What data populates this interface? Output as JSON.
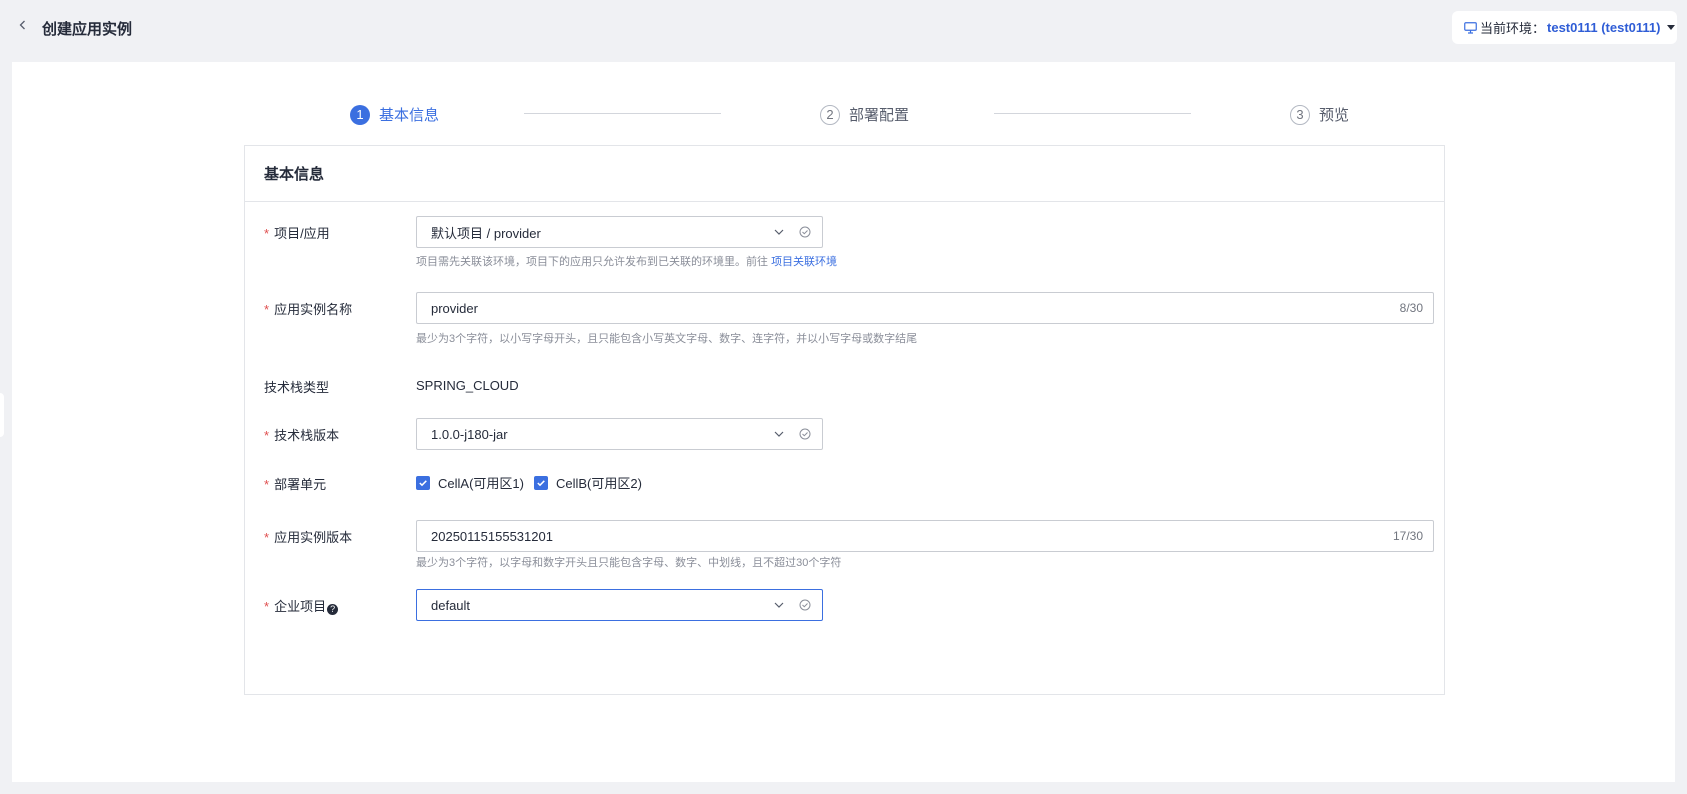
{
  "header": {
    "title": "创建应用实例",
    "env_label": "当前环境：",
    "env_value": "test0111 (test0111)"
  },
  "steps": [
    {
      "num": "1",
      "label": "基本信息",
      "state": "active"
    },
    {
      "num": "2",
      "label": "部署配置",
      "state": "inactive"
    },
    {
      "num": "3",
      "label": "预览",
      "state": "inactive"
    }
  ],
  "form": {
    "section_title": "基本信息",
    "project_app": {
      "label": "项目/应用",
      "value": "默认项目 / provider",
      "hint": "项目需先关联该环境，项目下的应用只允许发布到已关联的环境里。前往",
      "hint_link": "项目关联环境"
    },
    "instance_name": {
      "label": "应用实例名称",
      "value": "provider",
      "counter": "8/30",
      "hint": "最少为3个字符，以小写字母开头，且只能包含小写英文字母、数字、连字符，并以小写字母或数字结尾"
    },
    "stack_type": {
      "label": "技术栈类型",
      "value": "SPRING_CLOUD"
    },
    "stack_version": {
      "label": "技术栈版本",
      "value": "1.0.0-j180-jar"
    },
    "deploy_unit": {
      "label": "部署单元",
      "options": [
        "CellA(可用区1)",
        "CellB(可用区2)"
      ],
      "checked": [
        true,
        true
      ]
    },
    "instance_version": {
      "label": "应用实例版本",
      "value": "20250115155531201",
      "counter": "17/30",
      "hint": "最少为3个字符，以字母和数字开头且只能包含字母、数字、中划线，且不超过30个字符"
    },
    "enterprise_project": {
      "label": "企业项目",
      "value": "default"
    }
  }
}
